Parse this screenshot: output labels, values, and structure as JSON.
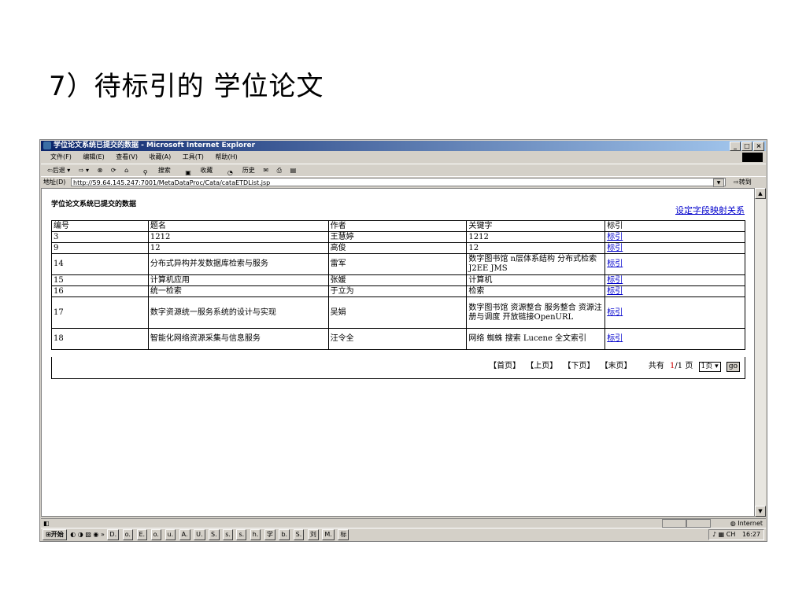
{
  "slide": {
    "title": "7）待标引的 学位论文"
  },
  "window": {
    "title": "学位论文系统已提交的数据 - Microsoft Internet Explorer",
    "buttons": [
      "_",
      "□",
      "×"
    ]
  },
  "menu": [
    "文件(F)",
    "编辑(E)",
    "查看(V)",
    "收藏(A)",
    "工具(T)",
    "帮助(H)"
  ],
  "toolbar": {
    "back": "⇦后退 ▾",
    "forward": "⇨ ▾",
    "search": "搜索",
    "favorites": "收藏",
    "history": "历史"
  },
  "address": {
    "label": "地址(D)",
    "url": "http://59.64.145.247:7001/MetaDataProc/Cata/cataETDList.jsp",
    "go": "转到"
  },
  "page": {
    "heading": "学位论文系统已提交的数据",
    "mapping_link": "设定字段映射关系",
    "columns": [
      "编号",
      "题名",
      "作者",
      "关键字",
      "标引"
    ],
    "rows": [
      {
        "id": "3",
        "title": "1212",
        "author": "王慧婷",
        "keywords": "1212",
        "action": "标引"
      },
      {
        "id": "9",
        "title": "12",
        "author": "高俊",
        "keywords": "12",
        "action": "标引"
      },
      {
        "id": "14",
        "title": "分布式异构并发数据库检索与服务",
        "author": "雷军",
        "keywords": "数字图书馆 n层体系结构 分布式检索 J2EE JMS",
        "action": "标引"
      },
      {
        "id": "15",
        "title": "计算机应用",
        "author": "张媛",
        "keywords": "计算机",
        "action": "标引"
      },
      {
        "id": "16",
        "title": "统一检索",
        "author": "于立为",
        "keywords": "检索",
        "action": "标引"
      },
      {
        "id": "17",
        "title": "数字资源统一服务系统的设计与实现",
        "author": "吴娟",
        "keywords": "数字图书馆 资源整合 服务整合 资源注册与调度 开放链接OpenURL",
        "action": "标引"
      },
      {
        "id": "18",
        "title": "智能化网络资源采集与信息服务",
        "author": "汪令全",
        "keywords": "网络 蜘蛛 搜索 Lucene 全文索引",
        "action": "标引"
      }
    ],
    "pager": {
      "first": "【首页】",
      "prev": "【上页】",
      "next": "【下页】",
      "last": "【末页】",
      "total_prefix": "共有",
      "current": "1",
      "total_suffix": "/1 页",
      "select_value": "1页 ▾",
      "go": "go"
    }
  },
  "status": {
    "zone": "Internet"
  },
  "taskbar": {
    "start": "开始",
    "tasks": [
      "D.",
      "o.",
      "E.",
      "o.",
      "u.",
      "A.",
      "U.",
      "S.",
      "s.",
      "s.",
      "h.",
      "学",
      "b.",
      "S.",
      "刘",
      "M.",
      "标"
    ],
    "tray_lang": "CH",
    "clock": "16:27"
  },
  "colors": {
    "link": "#0000cc",
    "titlebar": "#0a246a",
    "current_page": "#cc0000"
  }
}
